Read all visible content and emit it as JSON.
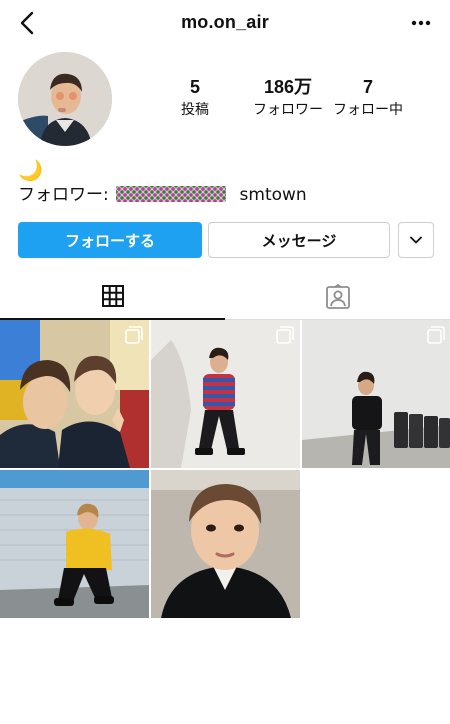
{
  "header": {
    "username": "mo.on_air",
    "back_icon": "chevron-left-icon",
    "more_icon": "more-horizontal-icon"
  },
  "profile": {
    "avatar": "profile-photo"
  },
  "stats": [
    {
      "value": "5",
      "label": "投稿"
    },
    {
      "value": "186万",
      "label": "フォロワー"
    },
    {
      "value": "7",
      "label": "フォロー中"
    }
  ],
  "bio": {
    "emoji": "🌙",
    "followers_prefix": "フォロワー:",
    "followers_suffix": "smtown"
  },
  "actions": {
    "follow_label": "フォローする",
    "message_label": "メッセージ",
    "more_icon": "chevron-down-icon",
    "follow_color": "#1fa1f1"
  },
  "tabs": [
    {
      "name": "grid",
      "icon": "grid-icon",
      "active": true
    },
    {
      "name": "tagged",
      "icon": "tagged-user-icon",
      "active": false
    }
  ],
  "posts": [
    {
      "desc": "two-people-selfie",
      "multiple": true
    },
    {
      "desc": "striped-sweater-pose",
      "multiple": true
    },
    {
      "desc": "hallway-black-tshirt",
      "multiple": true
    },
    {
      "desc": "yellow-hoodie-crouch",
      "multiple": false
    },
    {
      "desc": "closeup-selfie",
      "multiple": false
    }
  ]
}
